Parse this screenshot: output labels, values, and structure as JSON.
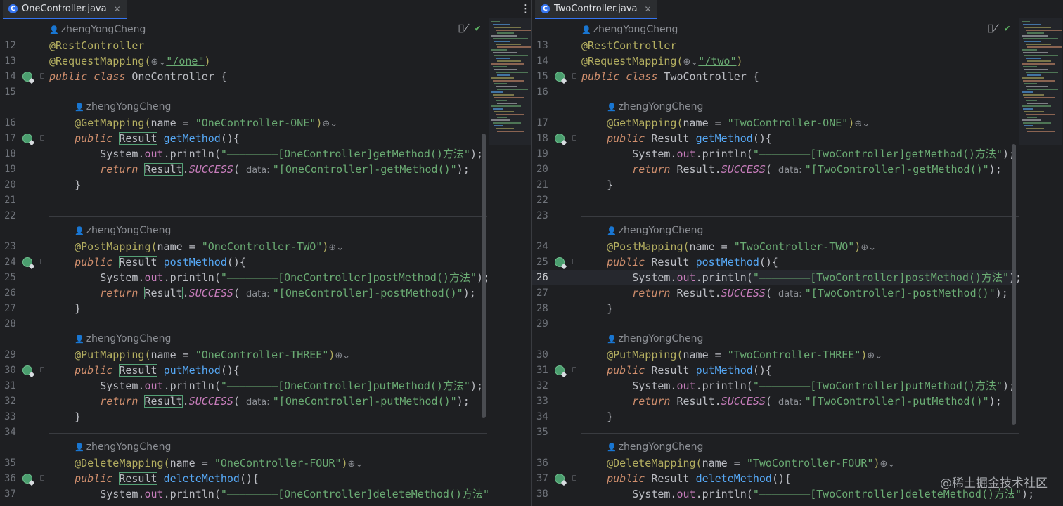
{
  "left": {
    "tab_title": "OneController.java",
    "tab_icon": "java-class-icon",
    "rows": [
      {
        "t": "author",
        "text": "zhengYongCheng"
      },
      {
        "n": "12",
        "code": [
          [
            "ann",
            "@RestController"
          ]
        ]
      },
      {
        "n": "13",
        "code": [
          [
            "ann",
            "@RequestMapping("
          ],
          [
            "hint",
            "⊕⌄"
          ],
          [
            "str link",
            "\"/one\""
          ],
          [
            "ann",
            ")"
          ]
        ]
      },
      {
        "n": "14",
        "g": true,
        "code": [
          [
            "kw",
            "public class "
          ],
          [
            "cls",
            "OneController {"
          ]
        ]
      },
      {
        "n": "15",
        "code": []
      },
      {
        "t": "author",
        "text": "zhengYongCheng"
      },
      {
        "n": "16",
        "code": [
          [
            "ann",
            "    @GetMapping("
          ],
          [
            "",
            "name = "
          ],
          [
            "str",
            "\"OneController-ONE\""
          ],
          [
            "ann",
            ")"
          ],
          [
            "hint",
            "⊕⌄"
          ]
        ]
      },
      {
        "n": "17",
        "g": true,
        "code": [
          [
            "kw",
            "    public "
          ],
          [
            "boxed",
            "Result"
          ],
          [
            "",
            " "
          ],
          [
            "mth",
            "getMethod"
          ],
          [
            "",
            "(){"
          ]
        ]
      },
      {
        "n": "18",
        "code": [
          [
            "",
            "        System."
          ],
          [
            "fld",
            "out"
          ],
          [
            "",
            ".println("
          ],
          [
            "str",
            "\"————————[OneController]getMethod()方法\""
          ],
          [
            "",
            ");"
          ]
        ]
      },
      {
        "n": "19",
        "code": [
          [
            "kw",
            "        return "
          ],
          [
            "boxed",
            "Result"
          ],
          [
            "",
            "."
          ],
          [
            "cst",
            "SUCCESS"
          ],
          [
            "",
            "( "
          ],
          [
            "hint",
            "data: "
          ],
          [
            "str",
            "\"[OneController]-getMethod()\""
          ],
          [
            "",
            ");"
          ]
        ]
      },
      {
        "n": "20",
        "code": [
          [
            "",
            "    }"
          ]
        ]
      },
      {
        "n": "21",
        "code": []
      },
      {
        "n": "22",
        "code": []
      },
      {
        "t": "sep"
      },
      {
        "t": "author",
        "text": "zhengYongCheng"
      },
      {
        "n": "23",
        "code": [
          [
            "ann",
            "    @PostMapping("
          ],
          [
            "",
            "name = "
          ],
          [
            "str",
            "\"OneController-TWO\""
          ],
          [
            "ann",
            ")"
          ],
          [
            "hint",
            "⊕⌄"
          ]
        ]
      },
      {
        "n": "24",
        "g": true,
        "code": [
          [
            "kw",
            "    public "
          ],
          [
            "boxed",
            "Result"
          ],
          [
            "",
            " "
          ],
          [
            "mth",
            "postMethod"
          ],
          [
            "",
            "(){"
          ]
        ]
      },
      {
        "n": "25",
        "code": [
          [
            "",
            "        System."
          ],
          [
            "fld",
            "out"
          ],
          [
            "",
            ".println("
          ],
          [
            "str",
            "\"————————[OneController]postMethod()方法\""
          ],
          [
            "",
            ");"
          ]
        ]
      },
      {
        "n": "26",
        "code": [
          [
            "kw",
            "        return "
          ],
          [
            "boxed",
            "Result"
          ],
          [
            "",
            "."
          ],
          [
            "cst",
            "SUCCESS"
          ],
          [
            "",
            "( "
          ],
          [
            "hint",
            "data: "
          ],
          [
            "str",
            "\"[OneController]-postMethod()\""
          ],
          [
            "",
            ");"
          ]
        ]
      },
      {
        "n": "27",
        "code": [
          [
            "",
            "    }"
          ]
        ]
      },
      {
        "n": "28",
        "code": []
      },
      {
        "t": "sep"
      },
      {
        "t": "author",
        "text": "zhengYongCheng"
      },
      {
        "n": "29",
        "code": [
          [
            "ann",
            "    @PutMapping("
          ],
          [
            "",
            "name = "
          ],
          [
            "str",
            "\"OneController-THREE\""
          ],
          [
            "ann",
            ")"
          ],
          [
            "hint",
            "⊕⌄"
          ]
        ]
      },
      {
        "n": "30",
        "g": true,
        "code": [
          [
            "kw",
            "    public "
          ],
          [
            "boxed",
            "Result"
          ],
          [
            "",
            " "
          ],
          [
            "mth",
            "putMethod"
          ],
          [
            "",
            "(){"
          ]
        ]
      },
      {
        "n": "31",
        "code": [
          [
            "",
            "        System."
          ],
          [
            "fld",
            "out"
          ],
          [
            "",
            ".println("
          ],
          [
            "str",
            "\"————————[OneController]putMethod()方法\""
          ],
          [
            "",
            ");"
          ]
        ]
      },
      {
        "n": "32",
        "code": [
          [
            "kw",
            "        return "
          ],
          [
            "boxed",
            "Result"
          ],
          [
            "",
            "."
          ],
          [
            "cst",
            "SUCCESS"
          ],
          [
            "",
            "( "
          ],
          [
            "hint",
            "data: "
          ],
          [
            "str",
            "\"[OneController]-putMethod()\""
          ],
          [
            "",
            ");"
          ]
        ]
      },
      {
        "n": "33",
        "code": [
          [
            "",
            "    }"
          ]
        ]
      },
      {
        "n": "34",
        "code": []
      },
      {
        "t": "sep"
      },
      {
        "t": "author",
        "text": "zhengYongCheng"
      },
      {
        "n": "35",
        "code": [
          [
            "ann",
            "    @DeleteMapping("
          ],
          [
            "",
            "name = "
          ],
          [
            "str",
            "\"OneController-FOUR\""
          ],
          [
            "ann",
            ")"
          ],
          [
            "hint",
            "⊕⌄"
          ]
        ]
      },
      {
        "n": "36",
        "g": true,
        "code": [
          [
            "kw",
            "    public "
          ],
          [
            "boxed",
            "Result"
          ],
          [
            "",
            " "
          ],
          [
            "mth",
            "deleteMethod"
          ],
          [
            "",
            "(){"
          ]
        ]
      },
      {
        "n": "37",
        "code": [
          [
            "",
            "        System."
          ],
          [
            "fld",
            "out"
          ],
          [
            "",
            ".println("
          ],
          [
            "str",
            "\"————————[OneController]deleteMethod()方法\""
          ]
        ]
      }
    ]
  },
  "right": {
    "tab_title": "TwoController.java",
    "tab_icon": "java-class-icon",
    "rows": [
      {
        "t": "author",
        "text": "zhengYongCheng"
      },
      {
        "n": "13",
        "code": [
          [
            "ann",
            "@RestController"
          ]
        ]
      },
      {
        "n": "14",
        "code": [
          [
            "ann",
            "@RequestMapping("
          ],
          [
            "hint",
            "⊕⌄"
          ],
          [
            "str link",
            "\"/two\""
          ],
          [
            "ann",
            ")"
          ]
        ]
      },
      {
        "n": "15",
        "g": true,
        "code": [
          [
            "kw",
            "public class "
          ],
          [
            "cls",
            "TwoController {"
          ]
        ]
      },
      {
        "n": "16",
        "code": []
      },
      {
        "t": "author",
        "text": "zhengYongCheng"
      },
      {
        "n": "17",
        "code": [
          [
            "ann",
            "    @GetMapping("
          ],
          [
            "",
            "name = "
          ],
          [
            "str",
            "\"TwoController-ONE\""
          ],
          [
            "ann",
            ")"
          ],
          [
            "hint",
            "⊕⌄"
          ]
        ]
      },
      {
        "n": "18",
        "g": true,
        "code": [
          [
            "kw",
            "    public "
          ],
          [
            "",
            "Result "
          ],
          [
            "mth",
            "getMethod"
          ],
          [
            "",
            "(){"
          ]
        ]
      },
      {
        "n": "19",
        "code": [
          [
            "",
            "        System."
          ],
          [
            "fld",
            "out"
          ],
          [
            "",
            ".println("
          ],
          [
            "str",
            "\"————————[TwoController]getMethod()方法\""
          ],
          [
            "",
            ");"
          ]
        ]
      },
      {
        "n": "20",
        "code": [
          [
            "kw",
            "        return "
          ],
          [
            "",
            "Result."
          ],
          [
            "cst",
            "SUCCESS"
          ],
          [
            "",
            "( "
          ],
          [
            "hint",
            "data: "
          ],
          [
            "str",
            "\"[TwoController]-getMethod()\""
          ],
          [
            "",
            ");"
          ]
        ]
      },
      {
        "n": "21",
        "code": [
          [
            "",
            "    }"
          ]
        ]
      },
      {
        "n": "22",
        "code": []
      },
      {
        "n": "23",
        "code": []
      },
      {
        "t": "sep"
      },
      {
        "t": "author",
        "text": "zhengYongCheng"
      },
      {
        "n": "24",
        "code": [
          [
            "ann",
            "    @PostMapping("
          ],
          [
            "",
            "name = "
          ],
          [
            "str",
            "\"TwoController-TWO\""
          ],
          [
            "ann",
            ")"
          ],
          [
            "hint",
            "⊕⌄"
          ]
        ]
      },
      {
        "n": "25",
        "g": true,
        "code": [
          [
            "kw",
            "    public "
          ],
          [
            "",
            "Result "
          ],
          [
            "mth",
            "postMethod"
          ],
          [
            "",
            "(){"
          ]
        ]
      },
      {
        "n": "26",
        "cur": true,
        "code": [
          [
            "",
            "        System."
          ],
          [
            "fld",
            "out"
          ],
          [
            "",
            ".println("
          ],
          [
            "str",
            "\"————————[TwoController]postMethod()方法\""
          ],
          [
            "",
            ");"
          ]
        ]
      },
      {
        "n": "27",
        "code": [
          [
            "kw",
            "        return "
          ],
          [
            "",
            "Result."
          ],
          [
            "cst",
            "SUCCESS"
          ],
          [
            "",
            "( "
          ],
          [
            "hint",
            "data: "
          ],
          [
            "str",
            "\"[TwoController]-postMethod()\""
          ],
          [
            "",
            ");"
          ]
        ]
      },
      {
        "n": "28",
        "code": [
          [
            "",
            "    }"
          ]
        ]
      },
      {
        "n": "29",
        "code": []
      },
      {
        "t": "sep"
      },
      {
        "t": "author",
        "text": "zhengYongCheng"
      },
      {
        "n": "30",
        "code": [
          [
            "ann",
            "    @PutMapping("
          ],
          [
            "",
            "name = "
          ],
          [
            "str",
            "\"TwoController-THREE\""
          ],
          [
            "ann",
            ")"
          ],
          [
            "hint",
            "⊕⌄"
          ]
        ]
      },
      {
        "n": "31",
        "g": true,
        "code": [
          [
            "kw",
            "    public "
          ],
          [
            "",
            "Result "
          ],
          [
            "mth",
            "putMethod"
          ],
          [
            "",
            "(){"
          ]
        ]
      },
      {
        "n": "32",
        "code": [
          [
            "",
            "        System."
          ],
          [
            "fld",
            "out"
          ],
          [
            "",
            ".println("
          ],
          [
            "str",
            "\"————————[TwoController]putMethod()方法\""
          ],
          [
            "",
            ");"
          ]
        ]
      },
      {
        "n": "33",
        "code": [
          [
            "kw",
            "        return "
          ],
          [
            "",
            "Result."
          ],
          [
            "cst",
            "SUCCESS"
          ],
          [
            "",
            "( "
          ],
          [
            "hint",
            "data: "
          ],
          [
            "str",
            "\"[TwoController]-putMethod()\""
          ],
          [
            "",
            ");"
          ]
        ]
      },
      {
        "n": "34",
        "code": [
          [
            "",
            "    }"
          ]
        ]
      },
      {
        "n": "35",
        "code": []
      },
      {
        "t": "sep"
      },
      {
        "t": "author",
        "text": "zhengYongCheng"
      },
      {
        "n": "36",
        "code": [
          [
            "ann",
            "    @DeleteMapping("
          ],
          [
            "",
            "name = "
          ],
          [
            "str",
            "\"TwoController-FOUR\""
          ],
          [
            "ann",
            ")"
          ],
          [
            "hint",
            "⊕⌄"
          ]
        ]
      },
      {
        "n": "37",
        "g": true,
        "code": [
          [
            "kw",
            "    public "
          ],
          [
            "",
            "Result "
          ],
          [
            "mth",
            "deleteMethod"
          ],
          [
            "",
            "(){"
          ]
        ]
      },
      {
        "n": "38",
        "code": [
          [
            "",
            "        System."
          ],
          [
            "fld",
            "out"
          ],
          [
            "",
            ".println("
          ],
          [
            "str",
            "\"————————[TwoController]deleteMethod()方法\""
          ],
          [
            "",
            ");"
          ]
        ]
      }
    ]
  },
  "toolbar": {
    "more_icon": "⋮",
    "close_icon": "✕",
    "reader_icon": "👁̸",
    "ok_icon": "✔"
  },
  "watermark": "@稀土掘金技术社区",
  "colors": {
    "accent": "#3574f0",
    "annotation": "#b3ae60",
    "keyword": "#cf8e6d",
    "string": "#6aab73",
    "method": "#56a8f5"
  }
}
